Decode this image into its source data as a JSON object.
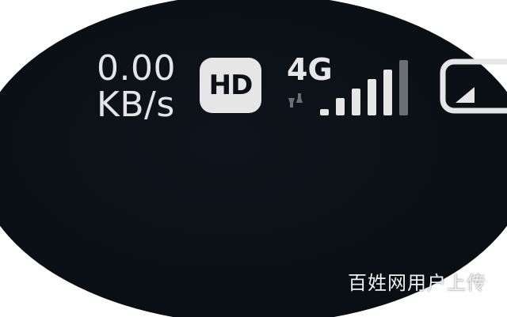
{
  "status_bar": {
    "network_speed": {
      "value": "0.00",
      "unit": "KB/s"
    },
    "hd_badge": "HD",
    "network_type": "4G",
    "signal_level": 4,
    "signal_max": 4,
    "icons": {
      "data_activity": "data-arrows-icon",
      "signal": "signal-bars-icon",
      "battery": "battery-icon"
    }
  },
  "watermark": "百姓网用户上传",
  "colors": {
    "background": "#0b1016",
    "foreground": "#e6e6e6",
    "inactive": "#6b6f74"
  }
}
